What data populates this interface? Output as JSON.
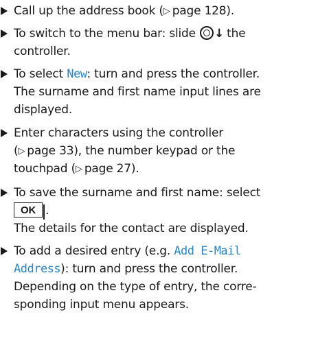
{
  "steps": [
    {
      "lines": [
        {
          "t1": "Call up the address book (",
          "ref": "page 128",
          "t2": ")."
        }
      ]
    },
    {
      "lines": [
        {
          "a": "To switch to the menu bar: slide",
          "b": "the"
        },
        {
          "a": "controller."
        }
      ]
    },
    {
      "lines": [
        {
          "a": "To select ",
          "hl": "New",
          "b": ": turn and press the controller."
        },
        {
          "a": "The surname and first name input lines are"
        },
        {
          "a": "displayed."
        }
      ]
    },
    {
      "lines": [
        {
          "a": "Enter characters using the controller"
        },
        {
          "a": "(",
          "ref": "page 33",
          "b": "), the number keypad or the"
        },
        {
          "a": "touchpad (",
          "ref": "page 27",
          "b": ")."
        }
      ]
    },
    {
      "lines": [
        {
          "a": "To save the surname and first name: select"
        },
        {
          "button": "OK",
          "b": "."
        },
        {
          "a": "The details for the contact are displayed."
        }
      ]
    },
    {
      "lines": [
        {
          "a": "To add a desired entry (e.g. ",
          "hl": "Add E-Mail"
        },
        {
          "hl": "Address",
          "b": "): turn and press the controller."
        },
        {
          "a": "Depending on the type of entry, the corre-"
        },
        {
          "a": "sponding input menu appears."
        }
      ]
    }
  ]
}
